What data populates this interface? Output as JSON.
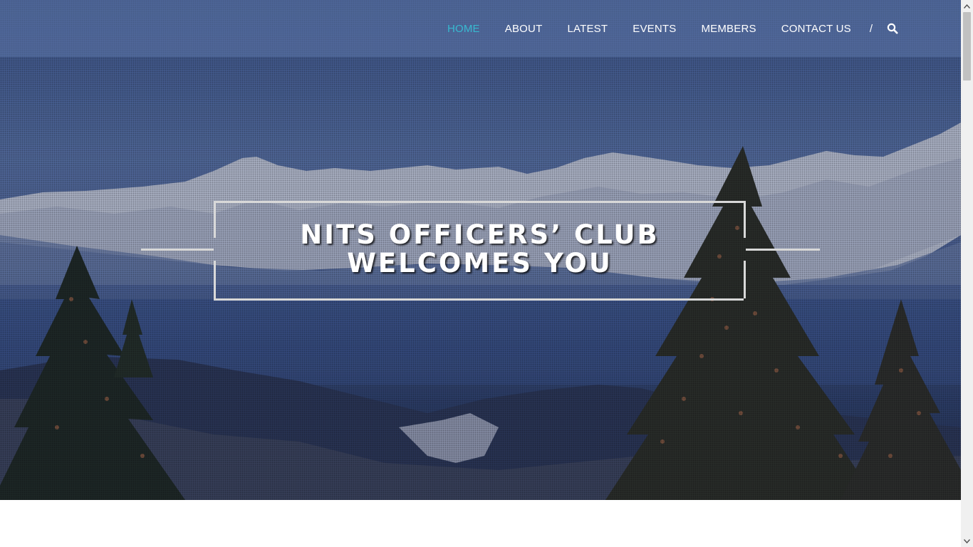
{
  "nav": {
    "items": [
      {
        "label": "HOME",
        "active": true
      },
      {
        "label": "ABOUT",
        "active": false
      },
      {
        "label": "LATEST",
        "active": false
      },
      {
        "label": "EVENTS",
        "active": false
      },
      {
        "label": "MEMBERS",
        "active": false
      },
      {
        "label": "CONTACT US",
        "active": false
      }
    ],
    "separator": "/",
    "search_icon": "search-icon",
    "active_color": "#38b9d0"
  },
  "hero": {
    "title_line1": "NITS OFFICERS’ CLUB",
    "title_line2": "WELCOMES YOU"
  },
  "colors": {
    "header_bg": "#5c76aa",
    "frame": "#d8d8d8",
    "text": "#ffffff"
  }
}
